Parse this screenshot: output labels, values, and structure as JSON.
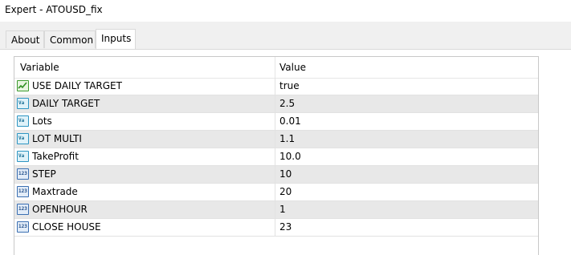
{
  "window": {
    "title": "Expert - ATOUSD_fix"
  },
  "tabs": [
    {
      "label": "About"
    },
    {
      "label": "Common"
    },
    {
      "label": "Inputs"
    }
  ],
  "table": {
    "columns": [
      "Variable",
      "Value"
    ],
    "rows": [
      {
        "name": "USE DAILY TARGET",
        "value": "true",
        "type_icon": "boolean-icon"
      },
      {
        "name": "DAILY TARGET",
        "value": "2.5",
        "type_icon": "double-icon"
      },
      {
        "name": "Lots",
        "value": "0.01",
        "type_icon": "double-icon"
      },
      {
        "name": "LOT MULTI",
        "value": "1.1",
        "type_icon": "double-icon"
      },
      {
        "name": "TakeProfit",
        "value": "10.0",
        "type_icon": "double-icon"
      },
      {
        "name": "STEP",
        "value": "10",
        "type_icon": "integer-icon"
      },
      {
        "name": "Maxtrade",
        "value": "20",
        "type_icon": "integer-icon"
      },
      {
        "name": "OPENHOUR",
        "value": "1",
        "type_icon": "integer-icon"
      },
      {
        "name": "CLOSE HOUSE",
        "value": "23",
        "type_icon": "integer-icon"
      }
    ]
  }
}
